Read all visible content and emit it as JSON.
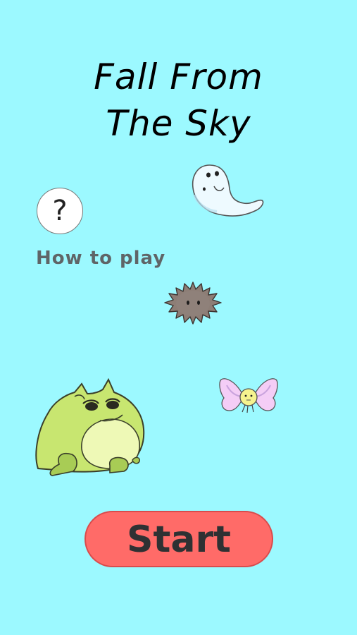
{
  "screen": {
    "background": "#9cf9ff"
  },
  "title": {
    "line1": "Fall From",
    "line2": "The Sky"
  },
  "help": {
    "icon": "question-mark-icon",
    "glyph": "?",
    "label": "How to play"
  },
  "sprites": {
    "ghost": "ghost-icon",
    "spiky_ball": "spiky-ball-icon",
    "butterfly": "butterfly-icon",
    "frog": "frog-character"
  },
  "start": {
    "label": "Start",
    "color": "#ff6b68"
  }
}
